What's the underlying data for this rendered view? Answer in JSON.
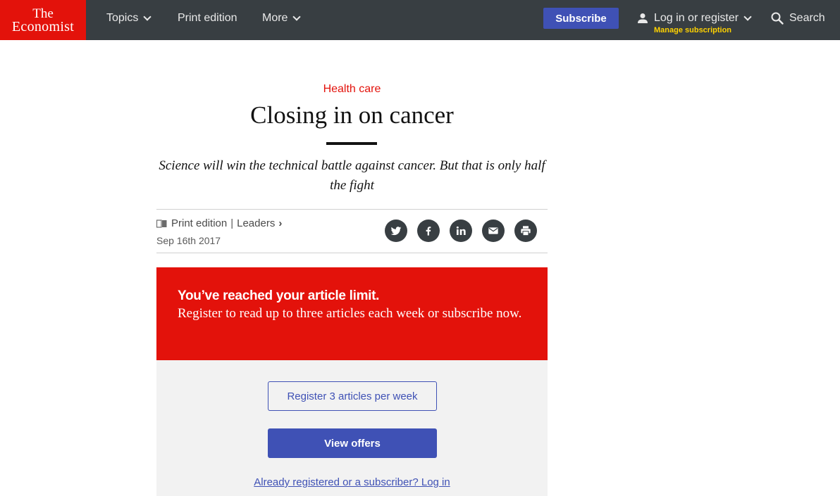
{
  "colors": {
    "brand_red": "#e3120b",
    "nav_background": "#383e42",
    "accent_blue": "#3f51b5",
    "manage_yellow": "#ffd200",
    "panel_grey": "#f2f2f2"
  },
  "header": {
    "logo_line1": "The",
    "logo_line2": "Economist",
    "nav": {
      "topics": "Topics",
      "print_edition": "Print edition",
      "more": "More"
    },
    "subscribe_label": "Subscribe",
    "login_label": "Log in or register",
    "manage_label": "Manage subscription",
    "search_label": "Search",
    "icons": [
      "chevron-down-icon",
      "user-icon",
      "search-icon"
    ]
  },
  "article": {
    "section": "Health care",
    "headline": "Closing in on cancer",
    "rubric": "Science will win the technical battle against cancer. But that is only half the fight",
    "breadcrumb": {
      "print_edition": "Print edition",
      "separator": "|",
      "leaders": "Leaders",
      "arrow": "›"
    },
    "date": "Sep 16th 2017",
    "share_icons": [
      "twitter-icon",
      "facebook-icon",
      "linkedin-icon",
      "email-icon",
      "print-icon"
    ]
  },
  "paywall": {
    "title": "You’ve reached your article limit.",
    "text": "Register to read up to three articles each week or subscribe now.",
    "register_label": "Register 3 articles per week",
    "offers_label": "View offers",
    "login_link": "Already registered or a subscriber? Log in"
  }
}
